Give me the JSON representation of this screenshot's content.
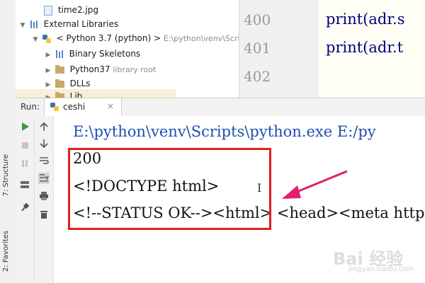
{
  "tool_strip": {
    "structure_label": "7: Structure",
    "favorites_label": "2: Favorites"
  },
  "project_tree": {
    "items": [
      {
        "label": "time2.jpg",
        "hint": "",
        "icon": "image-file-icon"
      },
      {
        "label": "External Libraries",
        "hint": "",
        "icon": "library-icon"
      },
      {
        "label": "< Python 3.7 (python) >",
        "hint": "E:\\python\\venv\\Scri",
        "icon": "python-icon"
      },
      {
        "label": "Binary Skeletons",
        "hint": "",
        "icon": "library-icon"
      },
      {
        "label": "Python37",
        "hint": "library root",
        "icon": "folder-icon"
      },
      {
        "label": "DLLs",
        "hint": "",
        "icon": "folder-icon"
      },
      {
        "label": "Lib",
        "hint": "",
        "icon": "folder-icon"
      }
    ]
  },
  "editor": {
    "line_numbers": [
      "400",
      "401",
      "402"
    ],
    "code_lines": [
      "print(adr.s",
      "print(adr.t"
    ]
  },
  "run_panel": {
    "label": "Run:",
    "tab_label": "ceshi"
  },
  "console": {
    "command": "E:\\python\\venv\\Scripts\\python.exe E:/py",
    "output_lines": [
      "200",
      "<!DOCTYPE html>",
      "<!--STATUS OK--><html> <head><meta http"
    ]
  },
  "watermark": {
    "brand": "Bai 经验",
    "url": "jingyan.baidu.com"
  },
  "colors": {
    "annotation": "#e02020",
    "arrow": "#e0206f",
    "command_text": "#1f4fb0"
  }
}
